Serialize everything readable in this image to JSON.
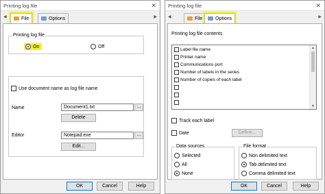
{
  "left_dialog": {
    "title": "Printing log file",
    "close_glyph": "✕",
    "tab_left_arrow": "◀",
    "tab_right_arrow": "▶",
    "tabs": [
      {
        "label": "File",
        "active": true,
        "highlighted": true,
        "icon": "file-tab-icon"
      },
      {
        "label": "Options",
        "active": false,
        "highlighted": false,
        "icon": "options-tab-icon"
      }
    ],
    "printing_log_group": {
      "label": "Printing log file",
      "on_label": "On",
      "off_label": "Off",
      "selected": "On"
    },
    "use_document_name_label": "Use document name as log file name",
    "use_document_name_checked": false,
    "name_label": "Name",
    "name_value": "Document1.txt",
    "browse_label": "...",
    "delete_label": "Delete",
    "editor_label": "Editor",
    "editor_value": "Notepad.exe",
    "edit_label": "Edit...",
    "buttons": {
      "ok": "OK",
      "cancel": "Cancel",
      "help": "Help"
    }
  },
  "right_dialog": {
    "title": "Printing log file",
    "close_glyph": "✕",
    "tab_left_arrow": "◀",
    "tab_right_arrow": "▶",
    "tabs": [
      {
        "label": "File",
        "active": false,
        "highlighted": false,
        "icon": "file-tab-icon"
      },
      {
        "label": "Options",
        "active": true,
        "highlighted": true,
        "icon": "options-tab-icon"
      }
    ],
    "contents_label": "Printing log file contents",
    "contents_items": [
      {
        "label": "Label file name",
        "checked": false
      },
      {
        "label": "Printer name",
        "checked": false
      },
      {
        "label": "Communications port",
        "checked": false
      },
      {
        "label": "Number of labels in the series",
        "checked": false
      },
      {
        "label": "Number of copies of each label",
        "checked": false
      },
      {
        "label": "",
        "checked": false
      },
      {
        "label": "",
        "checked": false
      },
      {
        "label": "",
        "checked": false
      }
    ],
    "scroll_up": "▲",
    "scroll_down": "▼",
    "track_each_label": "Track each label",
    "date_label": "Date",
    "define_label": "Define...",
    "data_sources": {
      "label": "Data sources",
      "options": [
        "Selected",
        "All",
        "None"
      ],
      "selected": "None"
    },
    "file_format": {
      "label": "File format",
      "options": [
        "Non delimited text",
        "Tab delimited text",
        "Comma delimited text"
      ],
      "selected": "Tab delimited text"
    },
    "buttons": {
      "ok": "OK",
      "cancel": "Cancel",
      "help": "Help"
    }
  },
  "colors": {
    "highlight": "#f3f32a",
    "dialog_bg": "#f0f0f0",
    "default_button_border": "#0078d7"
  }
}
